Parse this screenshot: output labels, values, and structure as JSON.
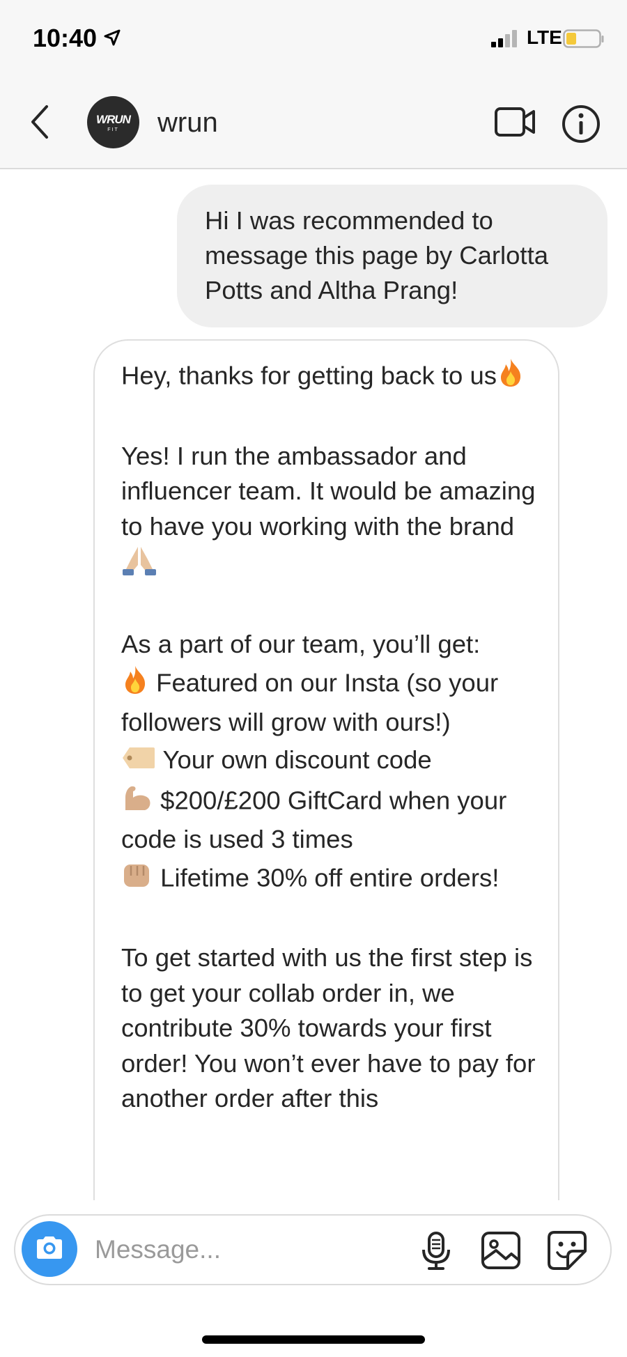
{
  "status_bar": {
    "time": "10:40",
    "network": "LTE",
    "icons": [
      "location-arrow-icon",
      "signal-icon",
      "battery-icon"
    ]
  },
  "header": {
    "avatar_text": "WRUN",
    "avatar_subtext": "FIT",
    "contact_name": "wrun",
    "icons": [
      "back-chevron-icon",
      "video-call-icon",
      "info-icon"
    ]
  },
  "messages": {
    "outgoing": {
      "text": "Hi I was recommended to message this page by Carlotta Potts and Altha Prang!"
    },
    "incoming": {
      "greeting": "Hey, thanks for getting back to us",
      "intro": "Yes! I run the ambassador and influencer team. It would be amazing to have you working with the brand",
      "benefits_heading": "As a part of our team, you’ll get:",
      "benefits": [
        {
          "icon": "fire-emoji",
          "text": "Featured on our Insta (so your followers will grow with ours!)"
        },
        {
          "icon": "tag-emoji",
          "text": "Your own discount code"
        },
        {
          "icon": "muscle-emoji",
          "text": "$200/£200 GiftCard when your code is used 3 times"
        },
        {
          "icon": "fist-emoji",
          "text": "Lifetime 30% off entire orders!"
        }
      ],
      "closing": "To get started with us the first step is to get your collab order in, we contribute 30% towards your first order! You won’t ever have to pay for another order after this"
    }
  },
  "composer": {
    "placeholder": "Message...",
    "icons": [
      "camera-icon",
      "microphone-icon",
      "gallery-icon",
      "sticker-icon"
    ]
  },
  "colors": {
    "accent": "#3797f0",
    "bubble_out": "#efefef",
    "bubble_in_border": "#dedede",
    "text": "#262626",
    "placeholder": "#9a9a9a"
  }
}
